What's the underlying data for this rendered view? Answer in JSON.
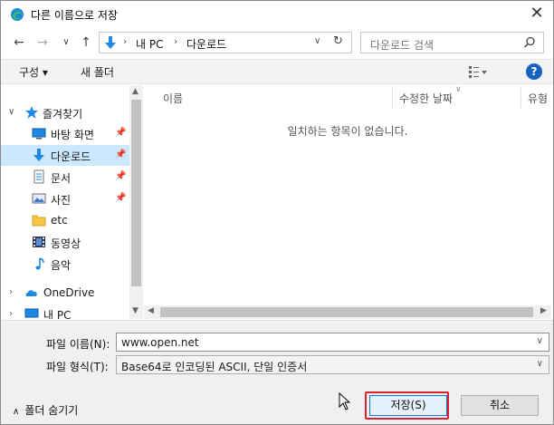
{
  "window": {
    "title": "다른 이름으로 저장",
    "close_glyph": "✕"
  },
  "nav_buttons": {
    "back": "←",
    "forward": "→",
    "recent": "∨",
    "up": "↑"
  },
  "address": {
    "icon": "download-arrow-icon",
    "crumbs": [
      "내 PC",
      "다운로드"
    ],
    "separator": "›",
    "dropdown": "∨",
    "refresh": "↻"
  },
  "search": {
    "placeholder": "다운로드 검색"
  },
  "toolbar": {
    "organize_label": "구성 ▾",
    "new_folder_label": "새 폴더",
    "help_label": "?"
  },
  "sidebar": {
    "items": [
      {
        "label": "즐겨찾기",
        "icon": "star-icon",
        "expanded": true
      },
      {
        "label": "바탕 화면",
        "icon": "desktop-icon",
        "pinned": true
      },
      {
        "label": "다운로드",
        "icon": "download-icon",
        "pinned": true,
        "selected": true
      },
      {
        "label": "문서",
        "icon": "document-icon",
        "pinned": true
      },
      {
        "label": "사진",
        "icon": "picture-icon",
        "pinned": true
      },
      {
        "label": "etc",
        "icon": "folder-icon"
      },
      {
        "label": "동영상",
        "icon": "video-icon"
      },
      {
        "label": "음악",
        "icon": "music-icon"
      },
      {
        "label": "OneDrive",
        "icon": "cloud-icon"
      },
      {
        "label": "내 PC",
        "icon": "computer-icon"
      }
    ],
    "pin_glyph": "📌",
    "collapse_glyph": "∨",
    "expand_glyph": "›"
  },
  "content": {
    "columns": [
      "이름",
      "수정한 날짜",
      "유형"
    ],
    "empty_message": "일치하는 항목이 없습니다."
  },
  "form": {
    "filename_label": "파일 이름(N):",
    "filename_value": "www.open.net",
    "filetype_label": "파일 형식(T):",
    "filetype_value": "Base64로 인코딩된 ASCII, 단일 인증서",
    "dropdown_glyph": "∨"
  },
  "footer": {
    "hide_folders_label": "폴더 숨기기",
    "hide_caret": "∧",
    "save_label": "저장(S)",
    "cancel_label": "취소"
  },
  "colors": {
    "selected_bg": "#cce8ff",
    "accent": "#0078d7",
    "highlight_border": "#e0202e",
    "help_blue": "#1565c0"
  }
}
